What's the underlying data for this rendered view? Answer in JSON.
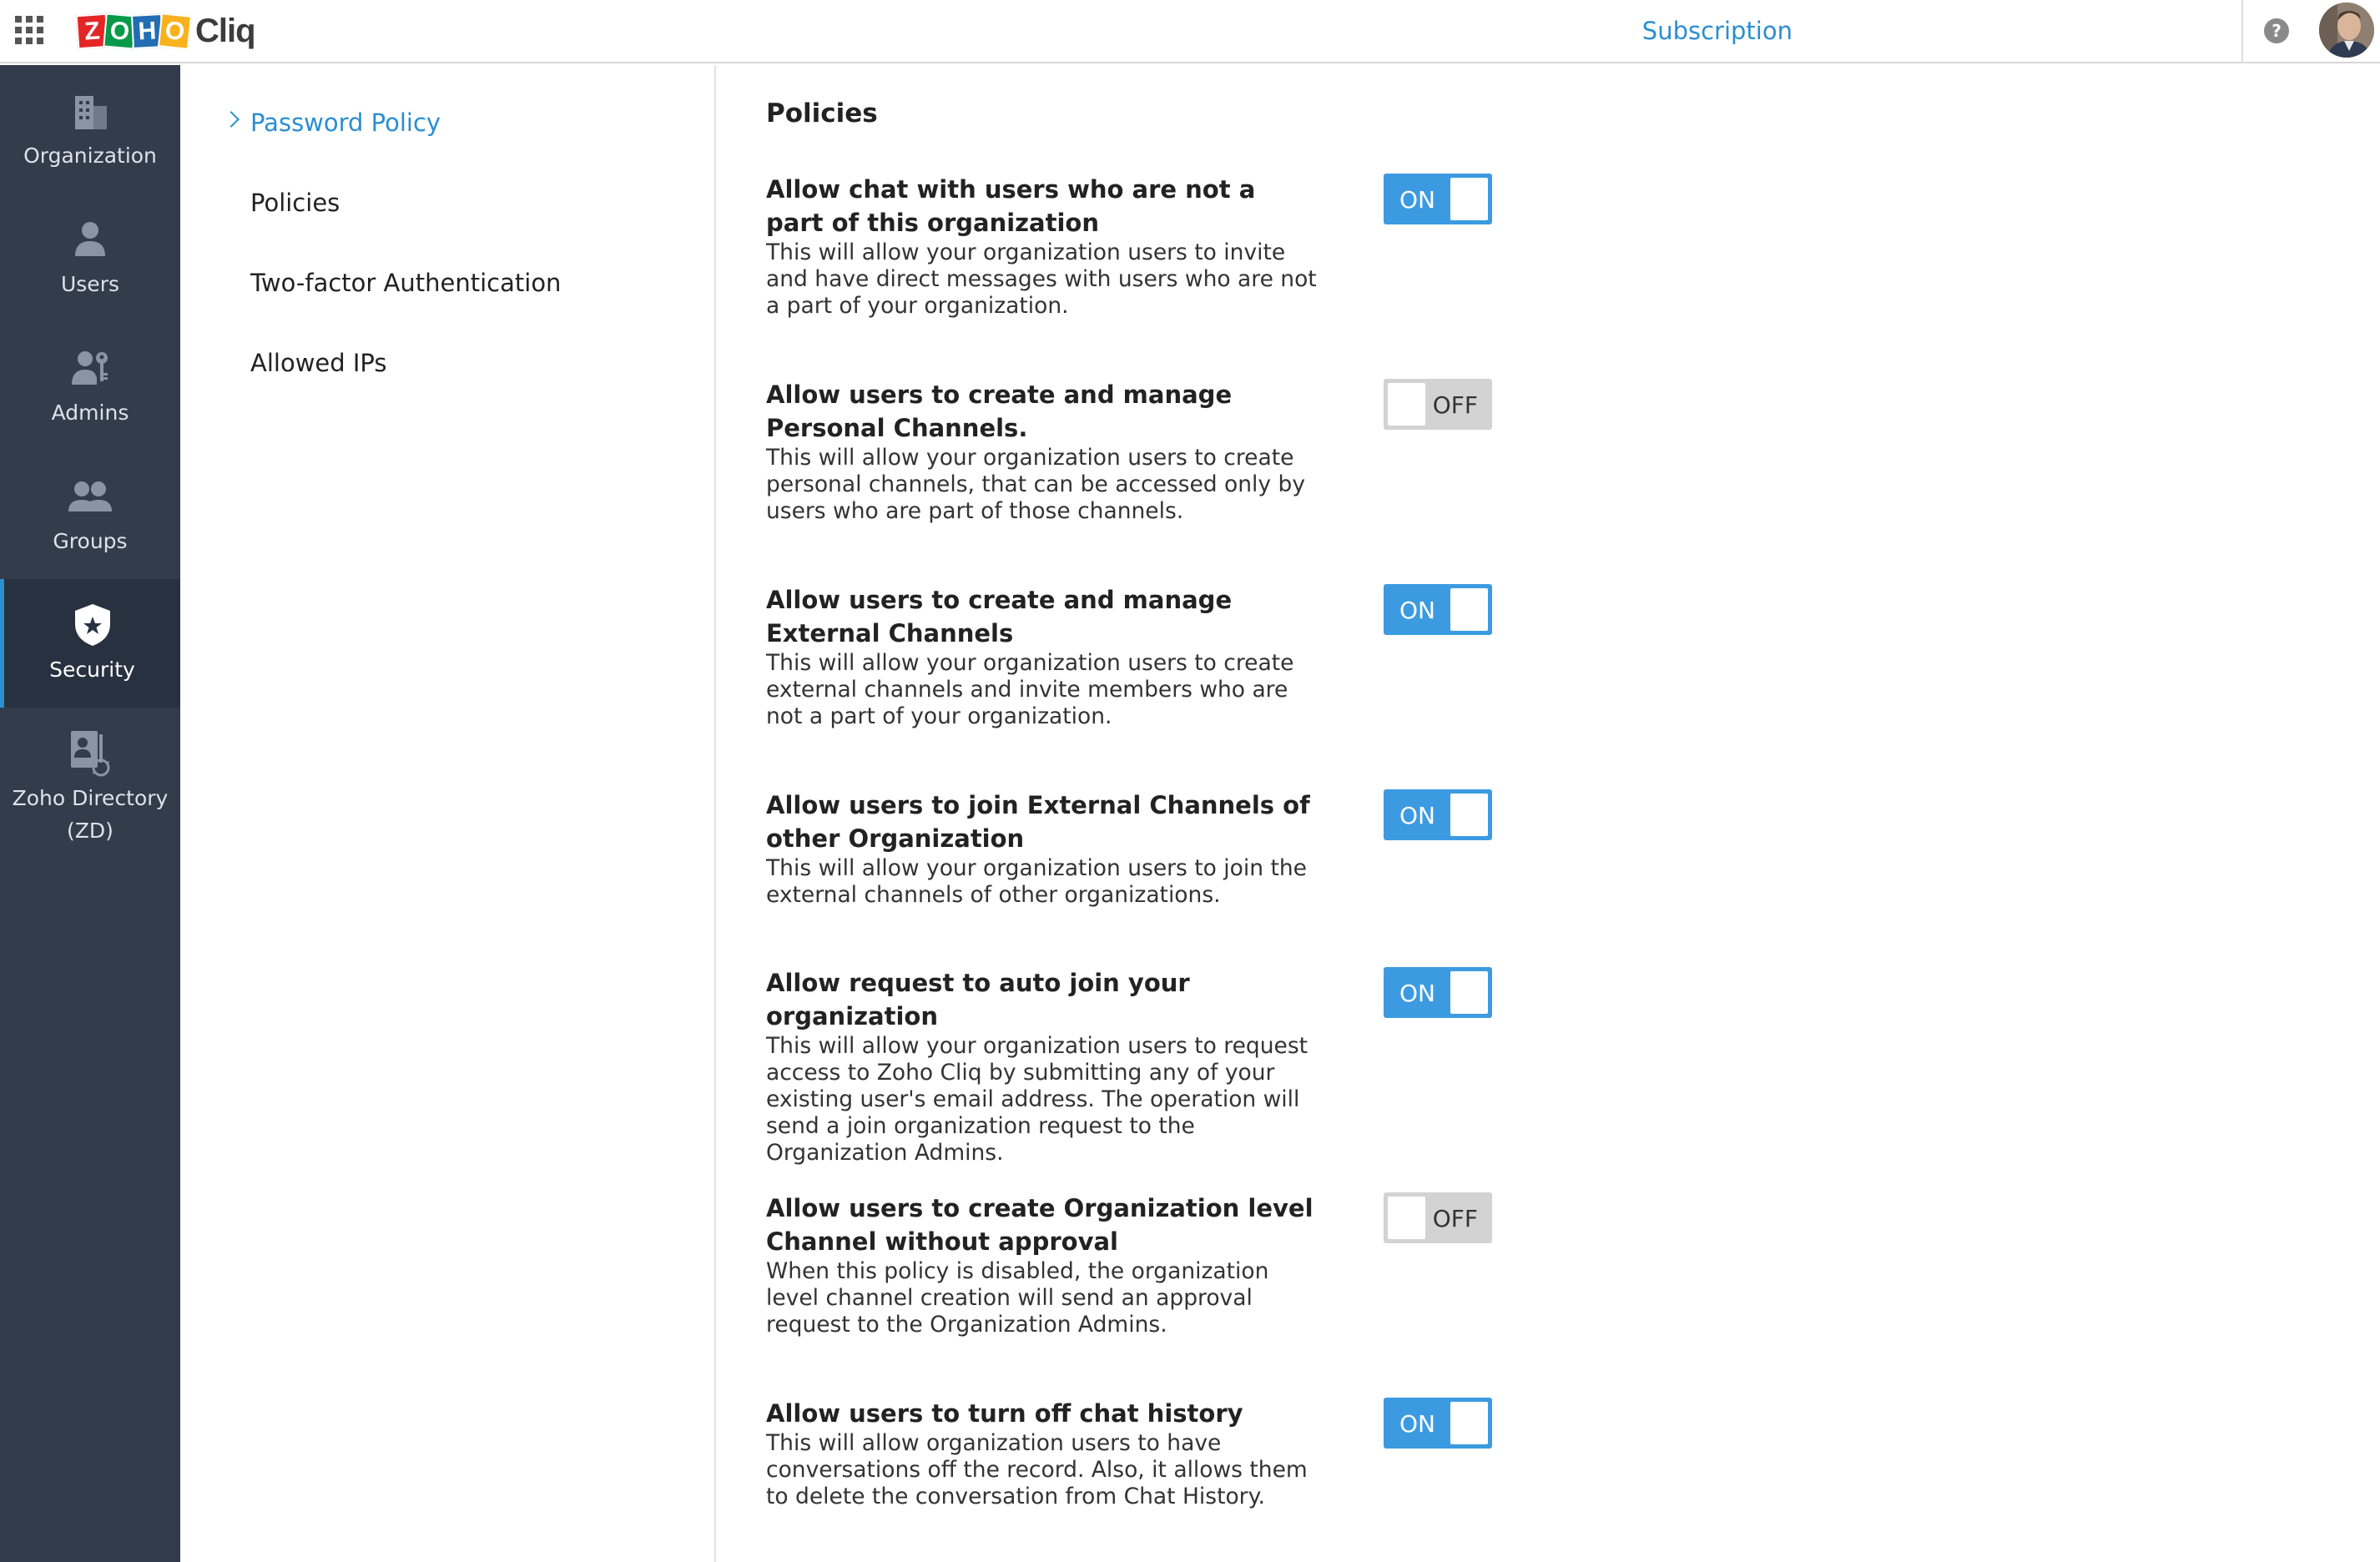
{
  "topbar": {
    "app_name": "Cliq",
    "logo_letters": [
      "Z",
      "O",
      "H",
      "O"
    ],
    "logo_colors": [
      "#e42527",
      "#089949",
      "#226db4",
      "#f9b21d"
    ],
    "subscription_label": "Subscription",
    "help_glyph": "?"
  },
  "leftnav": {
    "items": [
      {
        "label": "Organization",
        "icon": "organization-icon",
        "active": false
      },
      {
        "label": "Users",
        "icon": "user-icon",
        "active": false
      },
      {
        "label": "Admins",
        "icon": "admin-icon",
        "active": false
      },
      {
        "label": "Groups",
        "icon": "groups-icon",
        "active": false
      },
      {
        "label": "Security",
        "icon": "shield-icon",
        "active": true
      },
      {
        "label": "Zoho Directory (ZD)",
        "icon": "directory-icon",
        "active": false
      }
    ]
  },
  "subnav": {
    "items": [
      {
        "label": "Password Policy",
        "active": true
      },
      {
        "label": "Policies",
        "active": false
      },
      {
        "label": "Two-factor Authentication",
        "active": false
      },
      {
        "label": "Allowed IPs",
        "active": false
      }
    ]
  },
  "main": {
    "title": "Policies",
    "policies": [
      {
        "title": "Allow chat with users who are not a part of this organization",
        "description": "This will allow your organization users to invite and have direct messages with users who are not a part of your organization.",
        "state": "ON"
      },
      {
        "title": "Allow users to create and manage Personal Channels.",
        "description": "This will allow your organization users to create personal channels, that can be accessed only by users who are part of those channels.",
        "state": "OFF"
      },
      {
        "title": "Allow users to create and manage External Channels",
        "description": "This will allow your organization users to create external channels and invite members who are not a part of your organization.",
        "state": "ON"
      },
      {
        "title": "Allow users to join External Channels of other Organization",
        "description": "This will allow your organization users to join the external channels of other organizations.",
        "state": "ON"
      },
      {
        "title": "Allow request to auto join your organization",
        "description": "This will allow your organization users to request access to Zoho Cliq by submitting any of your existing user's email address. The operation will send a join organization request to the Organization Admins.",
        "state": "ON"
      },
      {
        "title": "Allow users to create Organization level Channel without approval",
        "description": "When this policy is disabled, the organization level channel creation will send an approval request to the Organization Admins.",
        "state": "OFF"
      },
      {
        "title": "Allow users to turn off chat history",
        "description": "This will allow organization users to have conversations off the record. Also, it allows them to delete the conversation from Chat History.",
        "state": "ON"
      }
    ]
  },
  "colors": {
    "accent": "#2b8ed0",
    "toggle_on": "#3c9be0",
    "toggle_off": "#d3d3d3",
    "sidebar": "#323c4b"
  }
}
